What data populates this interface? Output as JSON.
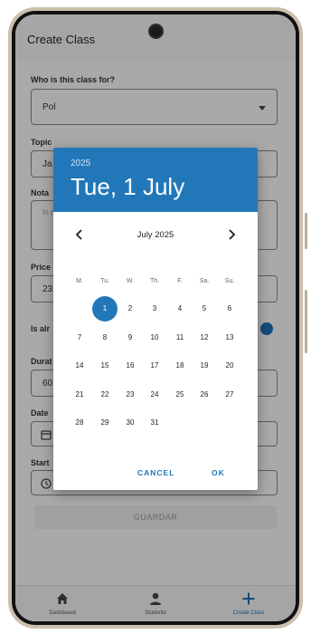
{
  "app": {
    "title": "Create Class",
    "form": {
      "who_label": "Who is this class for?",
      "who_value": "Pol",
      "topic_label": "Topic",
      "topic_value": "Ja",
      "notes_label": "Nota",
      "notes_placeholder": "In c",
      "price_label": "Price",
      "price_value": "23",
      "recurring_label": "Is alr",
      "duration_label": "Durat",
      "duration_value": "60",
      "date_label": "Date",
      "start_label": "Start",
      "save_label": "GUARDAR"
    },
    "bottom_nav": [
      {
        "label": "Dashboard",
        "icon": "home-icon"
      },
      {
        "label": "Students",
        "icon": "person-icon"
      },
      {
        "label": "Create Class",
        "icon": "plus-icon"
      }
    ]
  },
  "date_picker": {
    "year": "2025",
    "selected_display": "Tue, 1 July",
    "month_label": "July 2025",
    "weekdays": [
      "M.",
      "Tu.",
      "W.",
      "Th.",
      "F.",
      "Sa.",
      "Su."
    ],
    "selected_day": "1",
    "days": [
      "1",
      "2",
      "3",
      "4",
      "5",
      "6",
      "7",
      "8",
      "9",
      "10",
      "11",
      "12",
      "13",
      "14",
      "15",
      "16",
      "17",
      "18",
      "19",
      "20",
      "21",
      "22",
      "23",
      "24",
      "25",
      "26",
      "27",
      "28",
      "29",
      "30",
      "31"
    ],
    "cancel_label": "CANCEL",
    "ok_label": "OK",
    "accent_color": "#2277b9"
  }
}
